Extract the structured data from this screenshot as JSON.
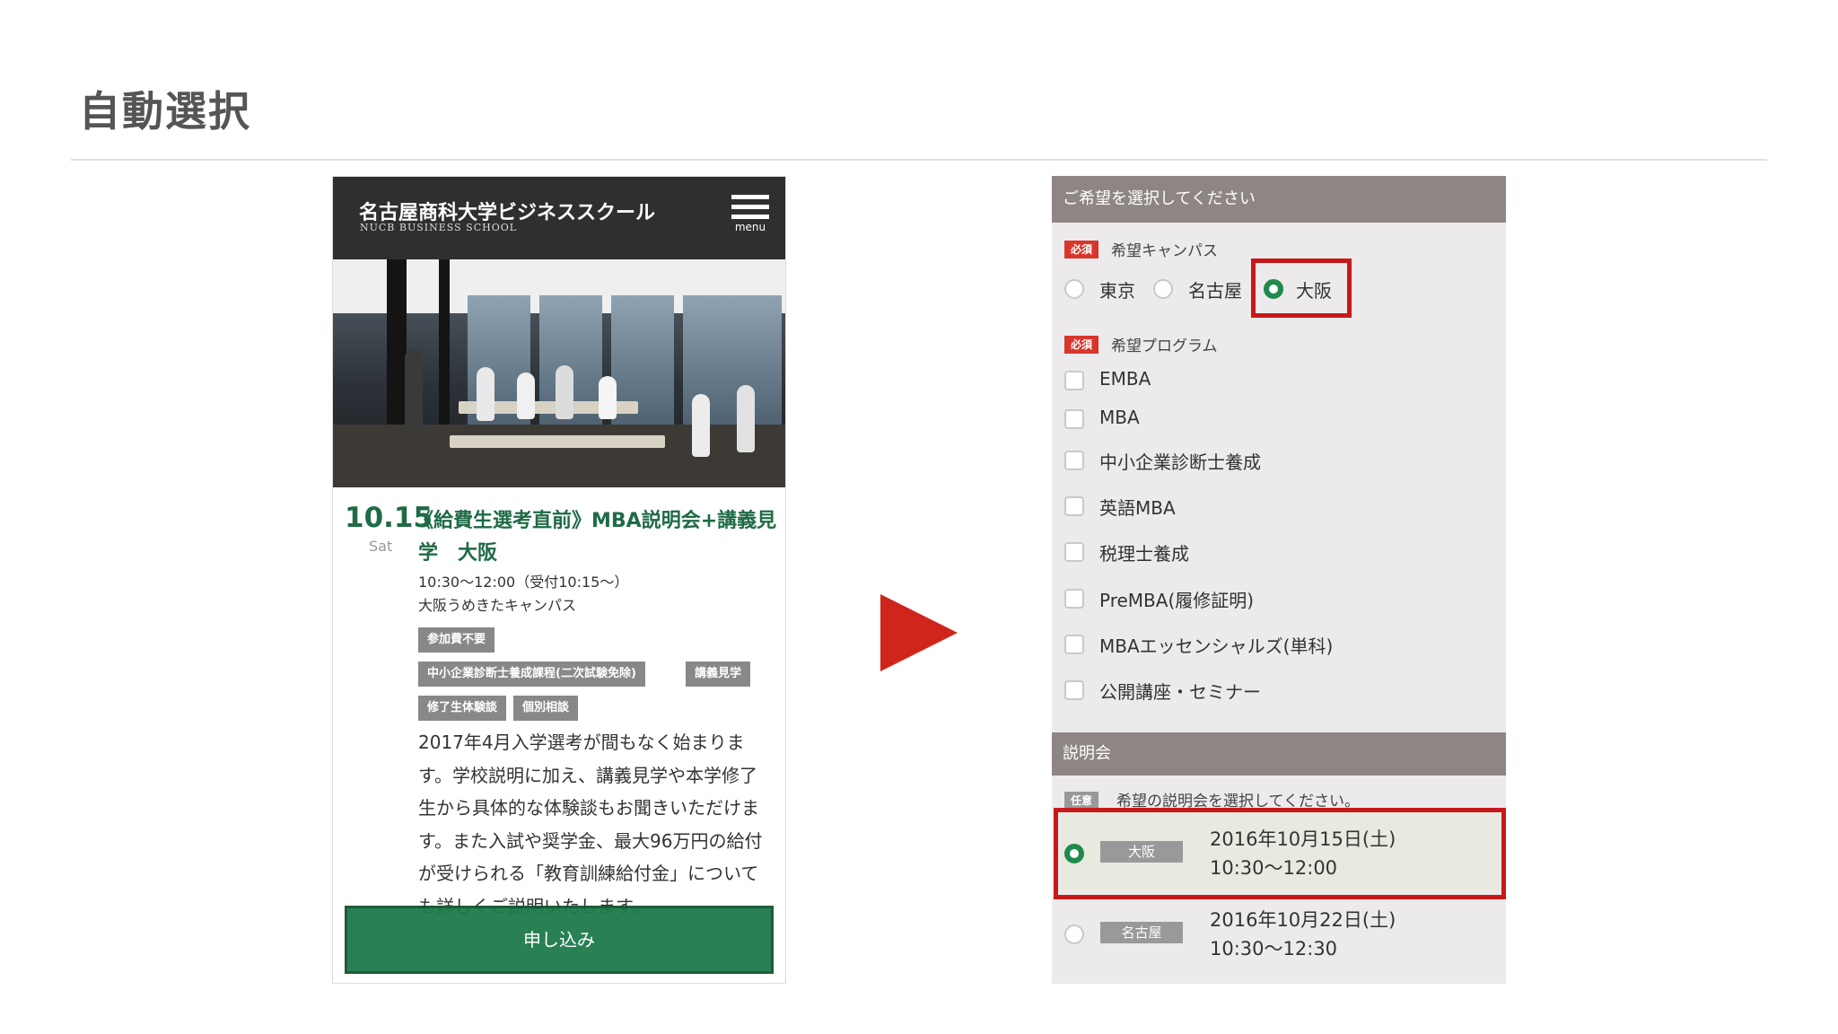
{
  "slide": {
    "title": "自動選択"
  },
  "phone": {
    "school_name": "名古屋商科大学ビジネススクール",
    "school_sub": "NUCB BUSINESS SCHOOL",
    "menu_label": "menu",
    "event": {
      "date": "10.15",
      "day": "Sat",
      "title": "《給費生選考直前》MBA説明会+講義見学　大阪",
      "time": "10:30〜12:00（受付10:15〜）",
      "place": "大阪うめきたキャンパス",
      "tags": [
        "参加費不要",
        "中小企業診断士養成課程(二次試験免除)",
        "講義見学",
        "修了生体験談",
        "個別相談"
      ],
      "body": "2017年4月入学選考が間もなく始まります。学校説明に加え、講義見学や本学修了生から具体的な体験談もお聞きいただけます。また入試や奨学金、最大96万円の給付が受けられる「教育訓練給付金」についても詳しくご説明いたします。"
    },
    "apply_label": "申し込み"
  },
  "form": {
    "header": "ご希望を選択してください",
    "required_badge": "必須",
    "optional_badge": "任意",
    "campus": {
      "label": "希望キャンパス",
      "options": [
        "東京",
        "名古屋",
        "大阪"
      ],
      "selected": "大阪"
    },
    "program": {
      "label": "希望プログラム",
      "options": [
        "EMBA",
        "MBA",
        "中小企業診断士養成",
        "英語MBA",
        "税理士養成",
        "PreMBA(履修証明)",
        "MBAエッセンシャルズ(単科)",
        "公開講座・セミナー"
      ]
    },
    "session": {
      "header": "説明会",
      "label": "希望の説明会を選択してください。",
      "slots": [
        {
          "campus": "大阪",
          "date": "2016年10月15日(土)",
          "time": "10:30〜12:00",
          "selected": true
        },
        {
          "campus": "名古屋",
          "date": "2016年10月22日(土)",
          "time": "10:30〜12:30",
          "selected": false
        }
      ]
    }
  },
  "colors": {
    "accent_green": "#1e7a4b",
    "highlight_red": "#c8191a",
    "arrow_red": "#d0251a"
  }
}
